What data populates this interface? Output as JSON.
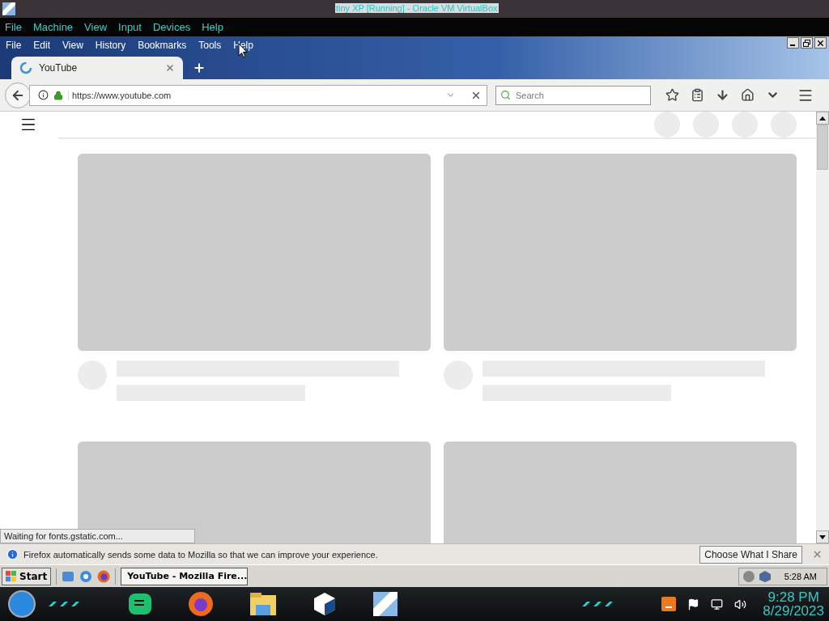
{
  "vm_window": {
    "title": "tiny XP [Running] - Oracle VM VirtualBox"
  },
  "vm_menu": [
    "File",
    "Machine",
    "View",
    "Input",
    "Devices",
    "Help"
  ],
  "browser_menu": [
    "File",
    "Edit",
    "View",
    "History",
    "Bookmarks",
    "Tools",
    "Help"
  ],
  "tabs": [
    {
      "label": "YouTube",
      "selected": true
    }
  ],
  "address_bar": {
    "value": "https://www.youtube.com"
  },
  "search": {
    "placeholder": "Search"
  },
  "status_text": "Waiting for fonts.gstatic.com...",
  "notification": {
    "text": "Firefox automatically sends some data to Mozilla so that we can improve your experience.",
    "button": "Choose What I Share"
  },
  "guest_taskbar": {
    "start": "Start",
    "tasks": [
      {
        "label": "YouTube - Mozilla Fire...",
        "selected": true
      }
    ],
    "time": "5:28 AM"
  },
  "host_taskbar": {
    "time": "9:28 PM",
    "date": "8/29/2023"
  }
}
